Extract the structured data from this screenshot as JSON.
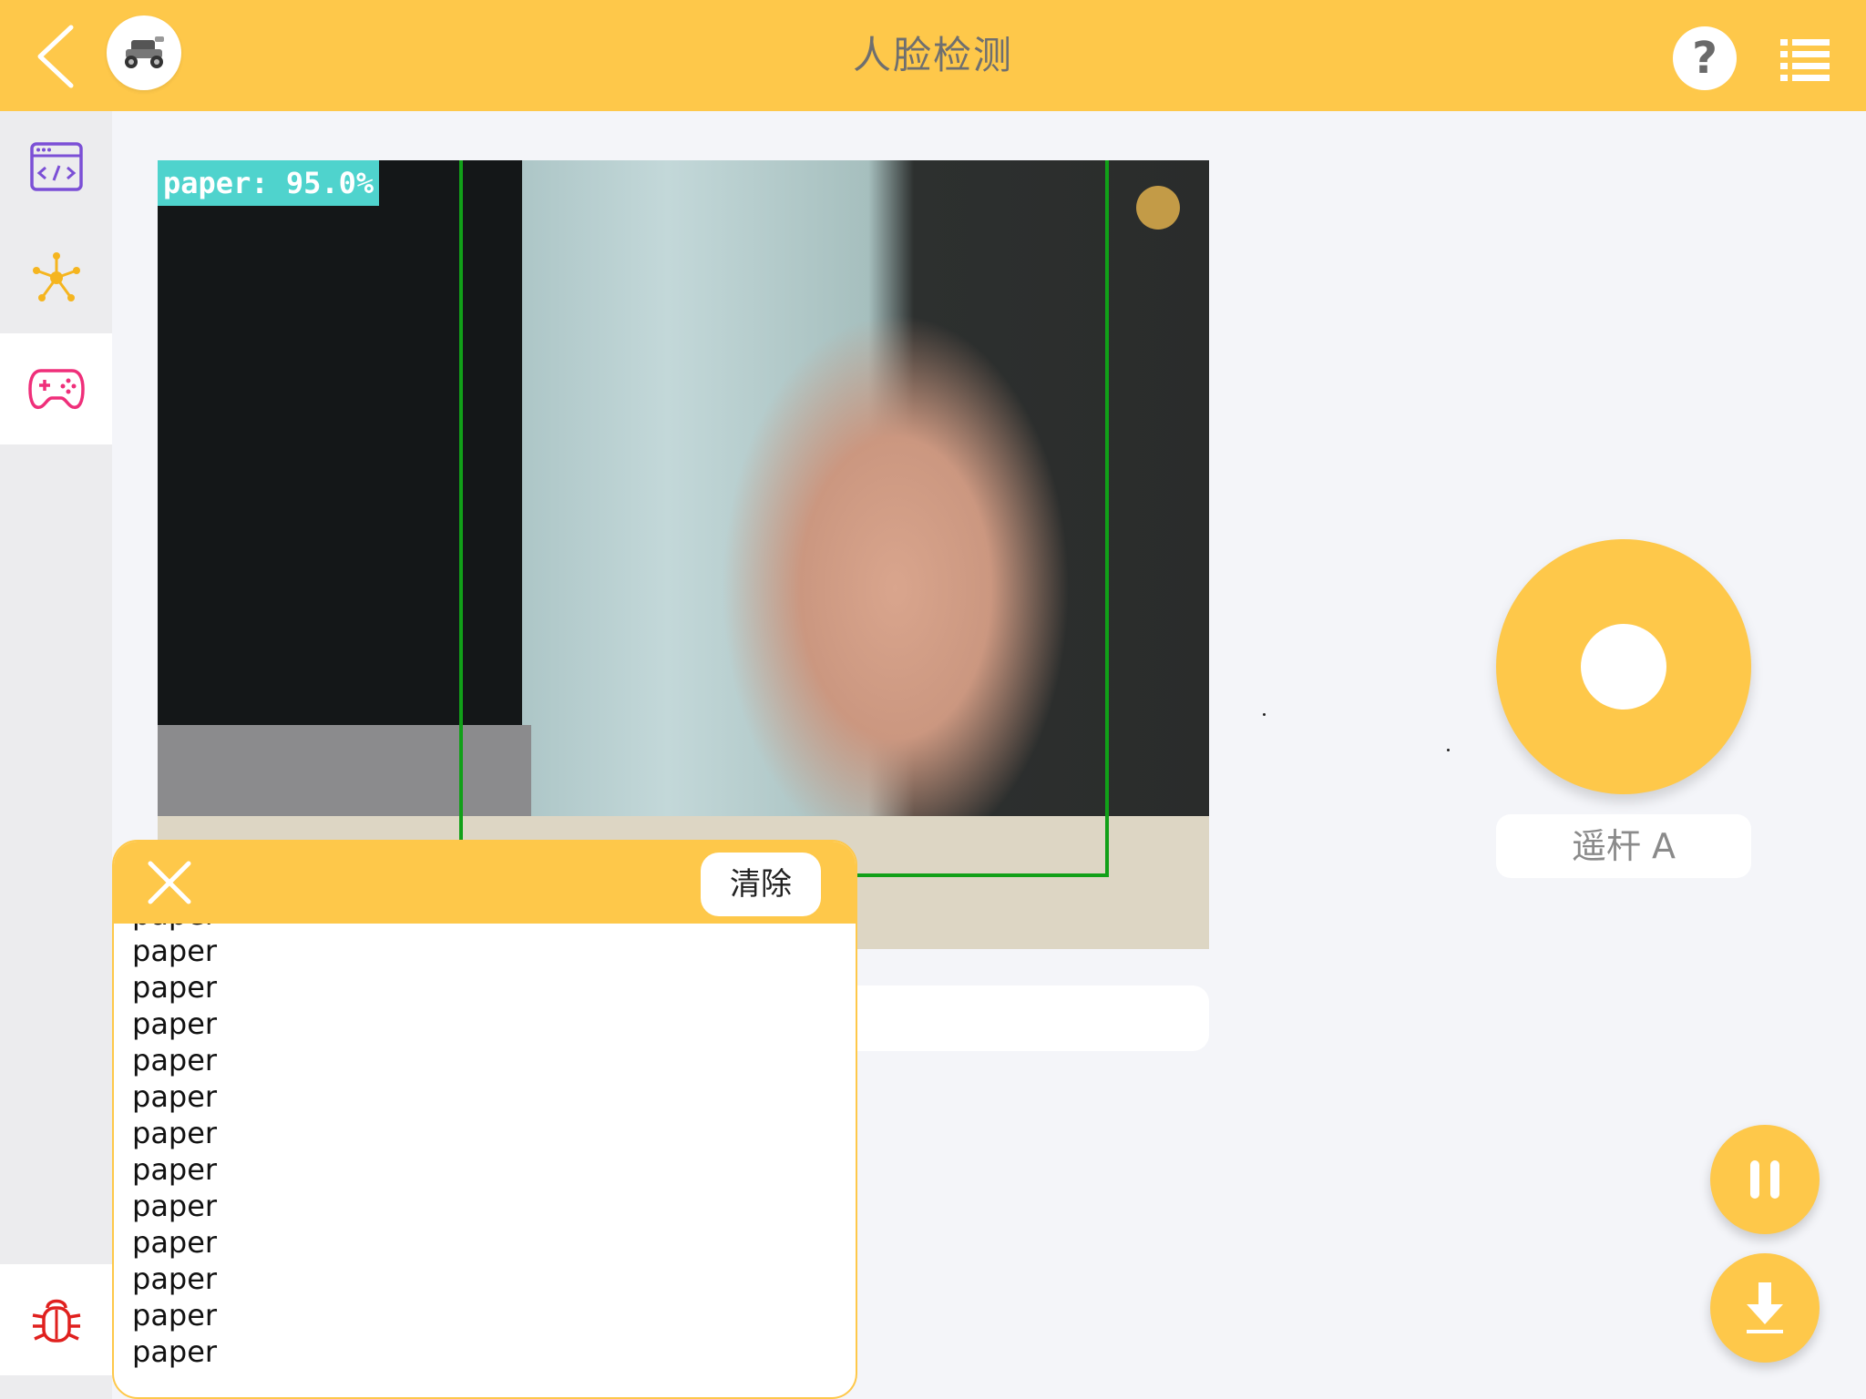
{
  "header": {
    "title": "人脸检测",
    "help_label": "?"
  },
  "camera": {
    "detection_label": "paper: 95.0%"
  },
  "joystick": {
    "label": "遥杆 A"
  },
  "console": {
    "clear_label": "清除",
    "lines": [
      "paper",
      "paper",
      "paper",
      "paper",
      "paper",
      "paper",
      "paper",
      "paper",
      "paper",
      "paper",
      "paper",
      "paper",
      "paper"
    ]
  },
  "icons": {
    "back": "chevron-left-icon",
    "robot": "robot-car-icon",
    "help": "help-icon",
    "menu": "list-menu-icon",
    "sidebar_code": "code-window-icon",
    "sidebar_network": "network-hub-icon",
    "sidebar_gamepad": "gamepad-icon",
    "sidebar_debug": "bug-icon",
    "pause": "pause-icon",
    "download": "download-icon",
    "close": "close-icon"
  },
  "colors": {
    "accent": "#fec84a",
    "sidebar_code": "#7b4fd6",
    "sidebar_network": "#f5b51f",
    "sidebar_gamepad": "#ef2f7a",
    "sidebar_debug": "#e0201e",
    "detection_box": "#11a018",
    "detection_label_bg": "#4fd3cd"
  }
}
